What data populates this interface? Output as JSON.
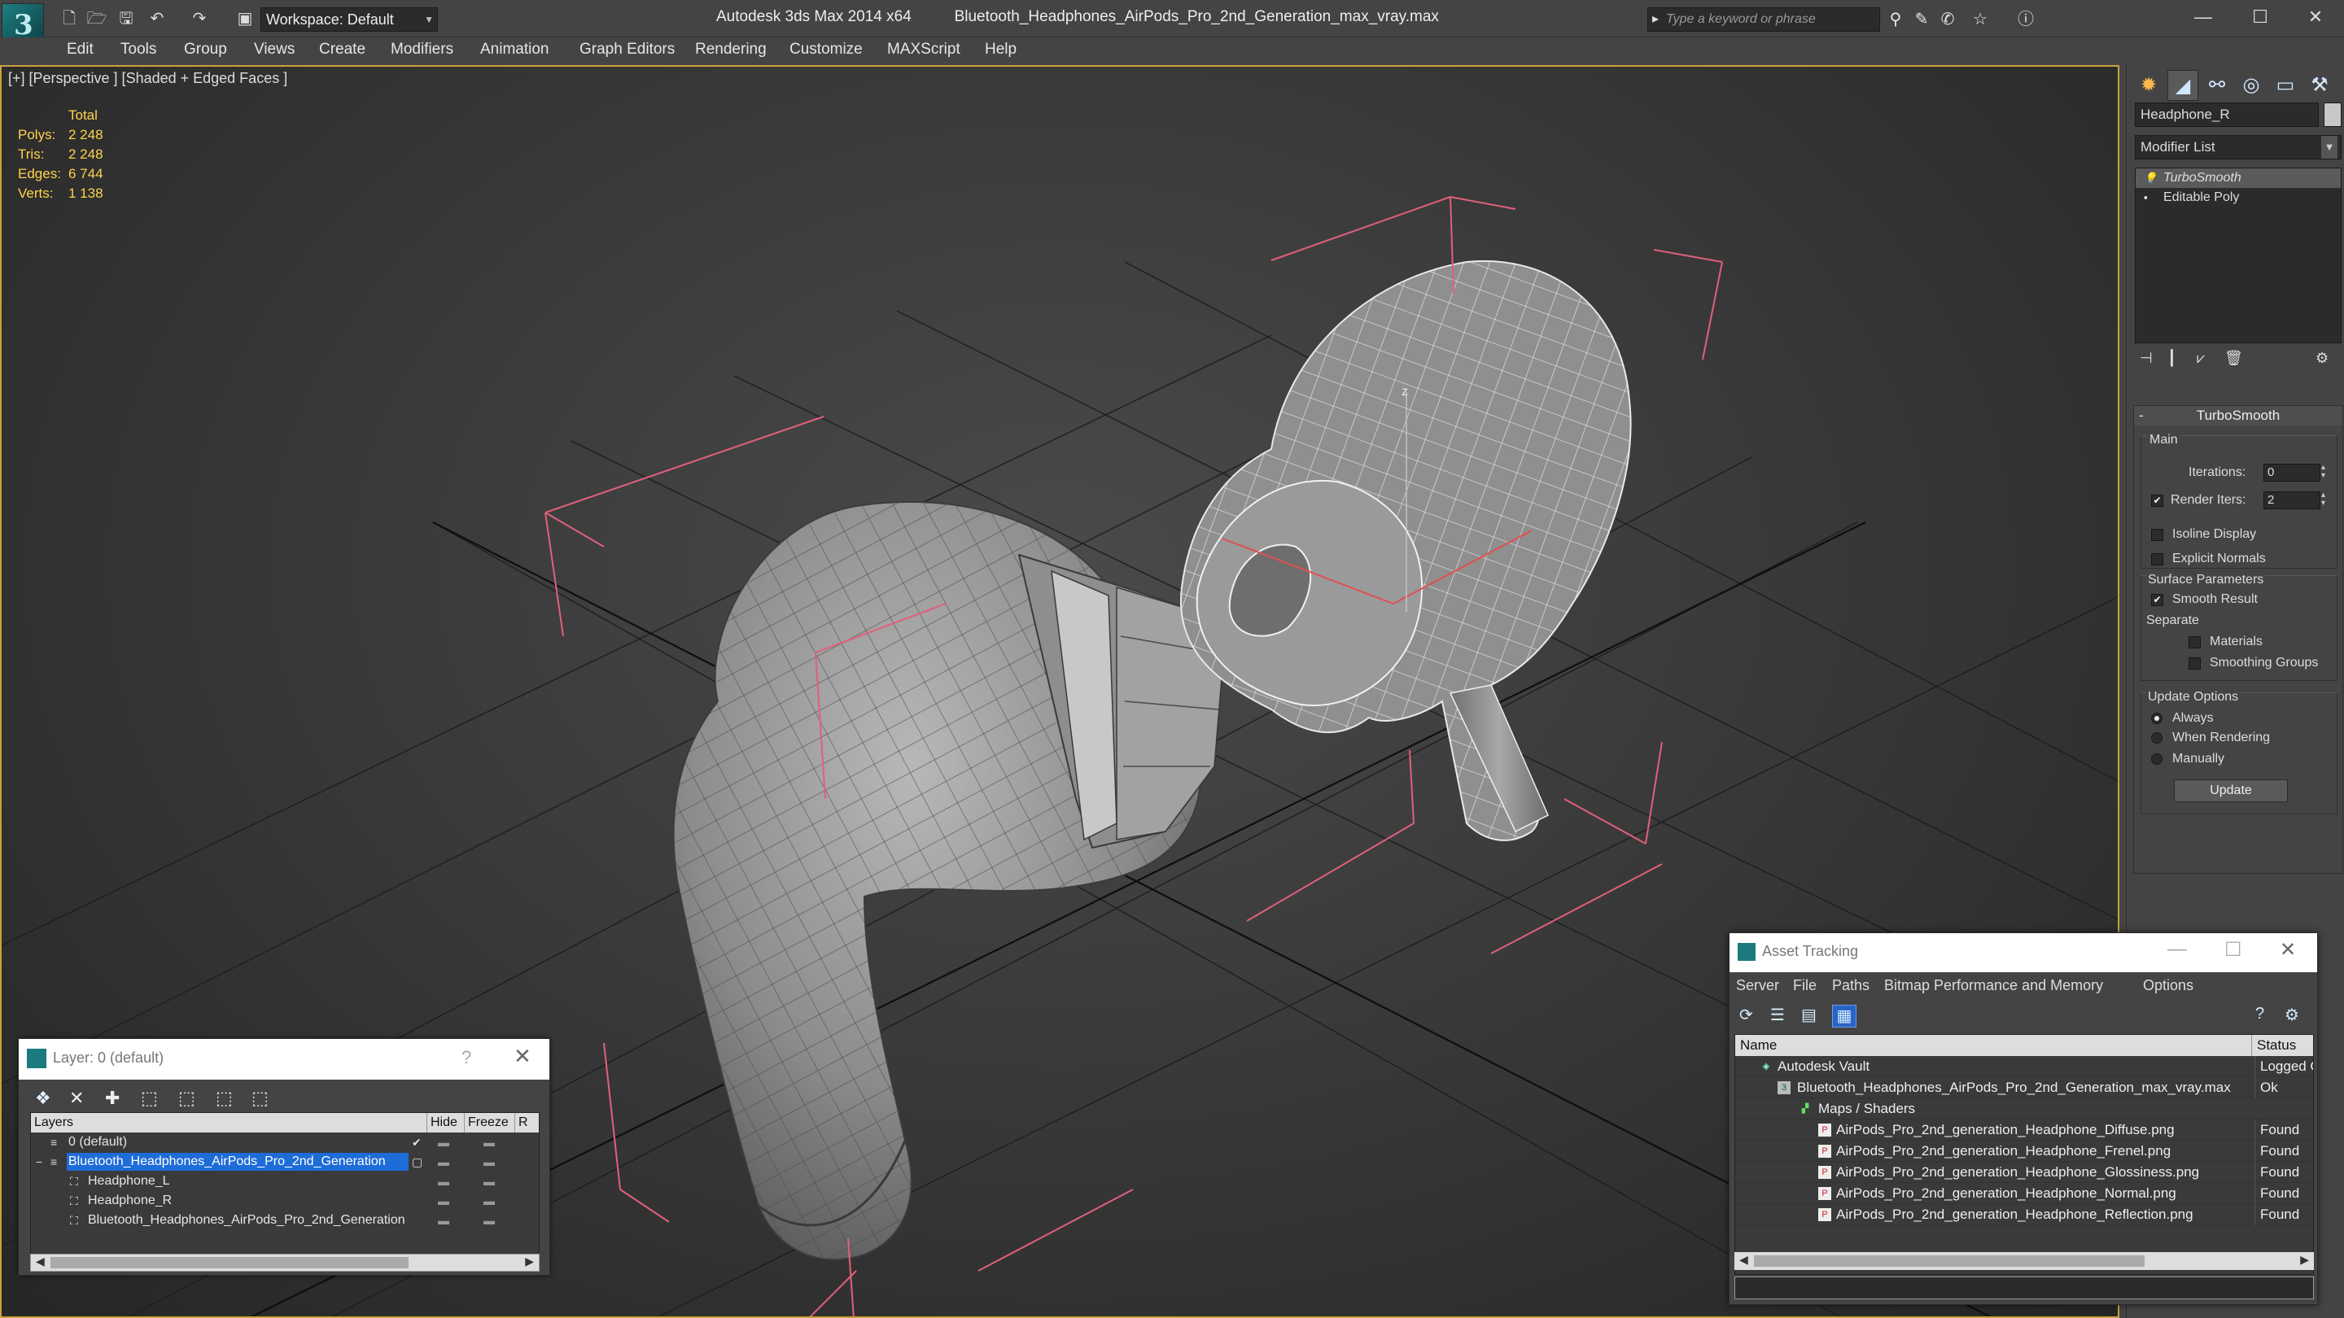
{
  "titlebar": {
    "workspace": "Workspace: Default",
    "app_title": "Autodesk 3ds Max 2014 x64",
    "file_name": "Bluetooth_Headphones_AirPods_Pro_2nd_Generation_max_vray.max",
    "search_placeholder": "Type a keyword or phrase",
    "minimize": "—",
    "maximize": "☐",
    "close": "✕"
  },
  "menu": [
    "Edit",
    "Tools",
    "Group",
    "Views",
    "Create",
    "Modifiers",
    "Animation",
    "Graph Editors",
    "Rendering",
    "Customize",
    "MAXScript",
    "Help"
  ],
  "viewport": {
    "label": "[+] [Perspective ] [Shaded + Edged Faces ]",
    "stats_header": "Total",
    "stats": [
      {
        "k": "Polys:",
        "v": "2 248"
      },
      {
        "k": "Tris:",
        "v": "2 248"
      },
      {
        "k": "Edges:",
        "v": "6 744"
      },
      {
        "k": "Verts:",
        "v": "1 138"
      }
    ],
    "bbox_color": "#e0607a",
    "axis_label": "z"
  },
  "command_panel": {
    "object_name": "Headphone_R",
    "modifier_list": "Modifier List",
    "stack": [
      {
        "label": "TurboSmooth",
        "selected": true
      },
      {
        "label": "Editable Poly",
        "selected": false
      }
    ],
    "rollout_title": "TurboSmooth",
    "main_label": "Main",
    "iterations_label": "Iterations:",
    "iterations_value": "0",
    "render_iters_label": "Render Iters:",
    "render_iters_value": "2",
    "isoline": "Isoline Display",
    "explicit_normals": "Explicit Normals",
    "surface_params": "Surface Parameters",
    "smooth_result": "Smooth Result",
    "separate": "Separate",
    "materials": "Materials",
    "smoothing_groups": "Smoothing Groups",
    "update_options": "Update Options",
    "always": "Always",
    "when_rendering": "When Rendering",
    "manually": "Manually",
    "update_button": "Update"
  },
  "layer_dialog": {
    "title": "Layer: 0 (default)",
    "help": "?",
    "close": "✕",
    "columns": [
      "Layers",
      "Hide",
      "Freeze",
      "R"
    ],
    "rows": [
      {
        "name": "0 (default)",
        "indent": 0,
        "selected": false,
        "check": "✔"
      },
      {
        "name": "Bluetooth_Headphones_AirPods_Pro_2nd_Generation",
        "indent": 0,
        "selected": true,
        "check": ""
      },
      {
        "name": "Headphone_L",
        "indent": 1,
        "selected": false,
        "check": ""
      },
      {
        "name": "Headphone_R",
        "indent": 1,
        "selected": false,
        "check": ""
      },
      {
        "name": "Bluetooth_Headphones_AirPods_Pro_2nd_Generation",
        "indent": 1,
        "selected": false,
        "check": ""
      }
    ]
  },
  "asset_dialog": {
    "title": "Asset Tracking",
    "menu": [
      "Server",
      "File",
      "Paths",
      "Bitmap Performance and Memory",
      "Options"
    ],
    "columns": [
      "Name",
      "Status"
    ],
    "rows": [
      {
        "name": "Autodesk Vault",
        "status": "Logged O",
        "indent": 0,
        "icon": "vault"
      },
      {
        "name": "Bluetooth_Headphones_AirPods_Pro_2nd_Generation_max_vray.max",
        "status": "Ok",
        "indent": 1,
        "icon": "max"
      },
      {
        "name": "Maps / Shaders",
        "status": "",
        "indent": 2,
        "icon": "folder"
      },
      {
        "name": "AirPods_Pro_2nd_generation_Headphone_Diffuse.png",
        "status": "Found",
        "indent": 3,
        "icon": "png"
      },
      {
        "name": "AirPods_Pro_2nd_generation_Headphone_Frenel.png",
        "status": "Found",
        "indent": 3,
        "icon": "png"
      },
      {
        "name": "AirPods_Pro_2nd_generation_Headphone_Glossiness.png",
        "status": "Found",
        "indent": 3,
        "icon": "png"
      },
      {
        "name": "AirPods_Pro_2nd_generation_Headphone_Normal.png",
        "status": "Found",
        "indent": 3,
        "icon": "png"
      },
      {
        "name": "AirPods_Pro_2nd_generation_Headphone_Reflection.png",
        "status": "Found",
        "indent": 3,
        "icon": "png"
      }
    ]
  }
}
